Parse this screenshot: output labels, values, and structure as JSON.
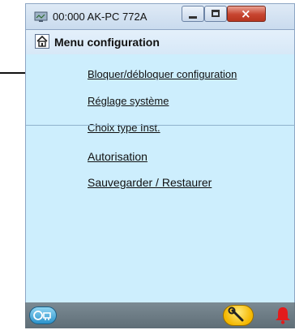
{
  "window": {
    "title": "00:000 AK-PC 772A",
    "close_glyph": "×",
    "icons": {
      "app": "monitor-icon",
      "minimize": "minimize-icon",
      "maximize": "maximize-icon",
      "close": "close-icon"
    }
  },
  "menu": {
    "title": "Menu configuration",
    "home_icon": "home-icon",
    "items": [
      {
        "label": "Bloquer/débloquer configuration"
      },
      {
        "label": "Réglage système"
      },
      {
        "label": "Choix type Inst."
      },
      {
        "label": "Autorisation"
      },
      {
        "label": "Sauvegarder / Restaurer"
      }
    ]
  },
  "bottombar": {
    "icons": {
      "left": "device-link-icon",
      "center": "wrench-icon",
      "right": "alarm-bell-icon"
    }
  },
  "annotation": {
    "icon": "pointer-arrow-icon"
  },
  "colors": {
    "content_bg": "#cdeefd",
    "titlebar": "#d6e4f3",
    "close_button": "#c7442f",
    "bottombar": "#6d7b84",
    "alarm": "#e31b1b",
    "wrench_button": "#f5c21b"
  }
}
